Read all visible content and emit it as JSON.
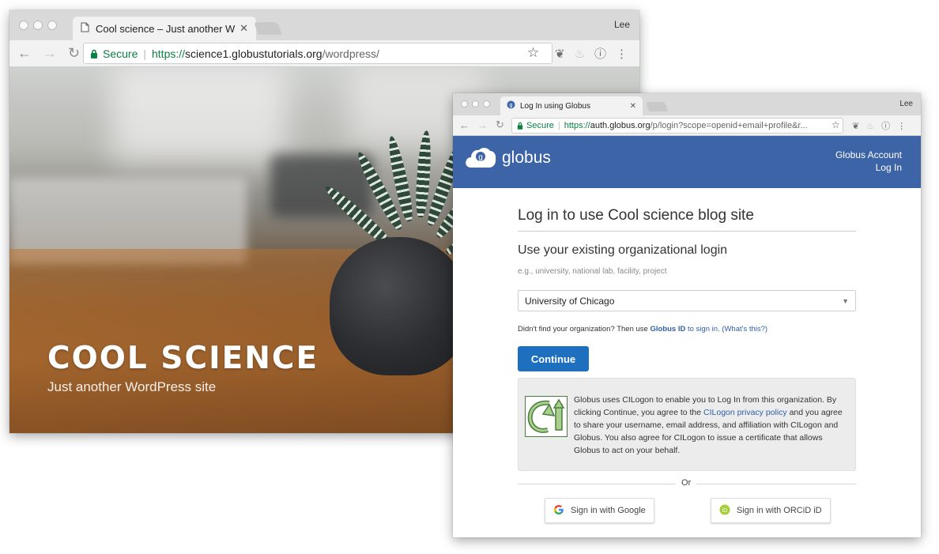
{
  "back_window": {
    "tab_title": "Cool science – Just another W",
    "profile": "Lee",
    "address": {
      "secure_label": "Secure",
      "scheme": "https://",
      "host": "science1.globustutorials.org",
      "path": "/wordpress/"
    },
    "site": {
      "title": "COOL SCIENCE",
      "tagline": "Just another WordPress site"
    }
  },
  "front_window": {
    "tab_title": "Log In using Globus",
    "profile": "Lee",
    "address": {
      "secure_label": "Secure",
      "scheme": "https://",
      "host": "auth.globus.org",
      "path": "/p/login?scope=openid+email+profile&r..."
    },
    "header": {
      "logo_text": "globus",
      "account_line1": "Globus Account",
      "account_line2": "Log In"
    },
    "login": {
      "heading": "Log in to use Cool science blog site",
      "subheading": "Use your existing organizational login",
      "hint": "e.g., university, national lab, facility, project",
      "selected_org": "University of Chicago",
      "not_found_prefix": "Didn't find your organization? Then use ",
      "globus_id": "Globus ID",
      "sign_in_suffix": " to sign in.",
      "whats_this": "(What's this?)",
      "continue_label": "Continue",
      "info_part1": "Globus uses CILogon to enable you to Log In from this organization. By clicking Continue, you agree to the ",
      "info_link": "CILogon privacy policy",
      "info_part2": " and you agree to share your username, email address, and affiliation with CILogon and Globus. You also agree for CILogon to issue a certificate that allows Globus to act on your behalf.",
      "or_label": "Or",
      "google_label": "Sign in with Google",
      "orcid_label": "Sign in with ORCiD iD"
    }
  },
  "colors": {
    "globus_header": "#3d64a6",
    "continue_button": "#1e70bf",
    "link": "#2f5fa8",
    "secure_green": "#0b8043"
  },
  "icons": [
    "back-arrow-icon",
    "forward-arrow-icon",
    "reload-icon",
    "lock-icon",
    "star-icon",
    "evernote-icon",
    "extension-icon",
    "info-icon",
    "kebab-menu-icon",
    "page-icon",
    "globus-favicon-icon",
    "close-icon",
    "cilogon-logo-icon",
    "google-icon",
    "orcid-icon",
    "dropdown-caret-icon"
  ]
}
